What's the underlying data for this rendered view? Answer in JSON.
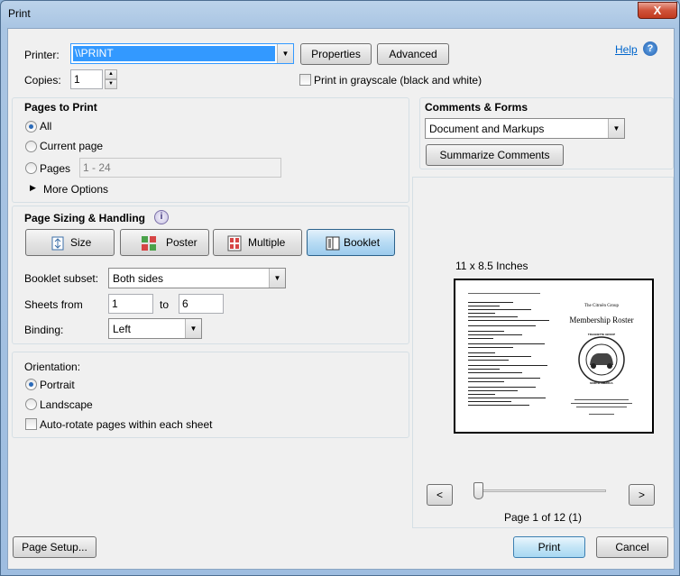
{
  "window": {
    "title": "Print",
    "close_label": "X"
  },
  "printer": {
    "label": "Printer:",
    "value": "\\\\PRINT",
    "properties_label": "Properties",
    "advanced_label": "Advanced",
    "help_label": "Help"
  },
  "copies": {
    "label": "Copies:",
    "value": "1"
  },
  "grayscale": {
    "label": "Print in grayscale (black and white)",
    "checked": false
  },
  "pages_to_print": {
    "title": "Pages to Print",
    "all_label": "All",
    "current_label": "Current page",
    "pages_label": "Pages",
    "pages_value": "1 - 24",
    "more_options_label": "More Options",
    "selected": "All"
  },
  "sizing": {
    "title": "Page Sizing & Handling",
    "buttons": [
      {
        "label": "Size",
        "icon": "size-icon"
      },
      {
        "label": "Poster",
        "icon": "poster-icon"
      },
      {
        "label": "Multiple",
        "icon": "multiple-icon"
      },
      {
        "label": "Booklet",
        "icon": "booklet-icon",
        "selected": true
      }
    ],
    "booklet_subset_label": "Booklet subset:",
    "booklet_subset_value": "Both sides",
    "sheets_from_label": "Sheets from",
    "sheets_from_value": "1",
    "to_label": "to",
    "sheets_to_value": "6",
    "binding_label": "Binding:",
    "binding_value": "Left"
  },
  "orientation": {
    "title": "Orientation:",
    "portrait_label": "Portrait",
    "landscape_label": "Landscape",
    "selected": "Portrait",
    "autorotate_label": "Auto-rotate pages within each sheet",
    "autorotate_checked": false
  },
  "comments": {
    "title": "Comments & Forms",
    "value": "Document and Markups",
    "summarize_label": "Summarize Comments"
  },
  "preview": {
    "size_label": "11 x 8.5 Inches",
    "page_label": "Page 1 of 12 (1)",
    "prev_label": "<",
    "next_label": ">",
    "slider_position": 0.0,
    "right_page": {
      "org": "The Citroën Group",
      "title": "Membership Roster",
      "seal_top": "TRAGNETTE GROUP",
      "seal_bottom": "NORTH AMERICA"
    }
  },
  "footer": {
    "page_setup_label": "Page Setup...",
    "print_label": "Print",
    "cancel_label": "Cancel"
  },
  "colors": {
    "accent": "#3399ff",
    "link": "#0066cc",
    "close": "#c13a1e"
  }
}
